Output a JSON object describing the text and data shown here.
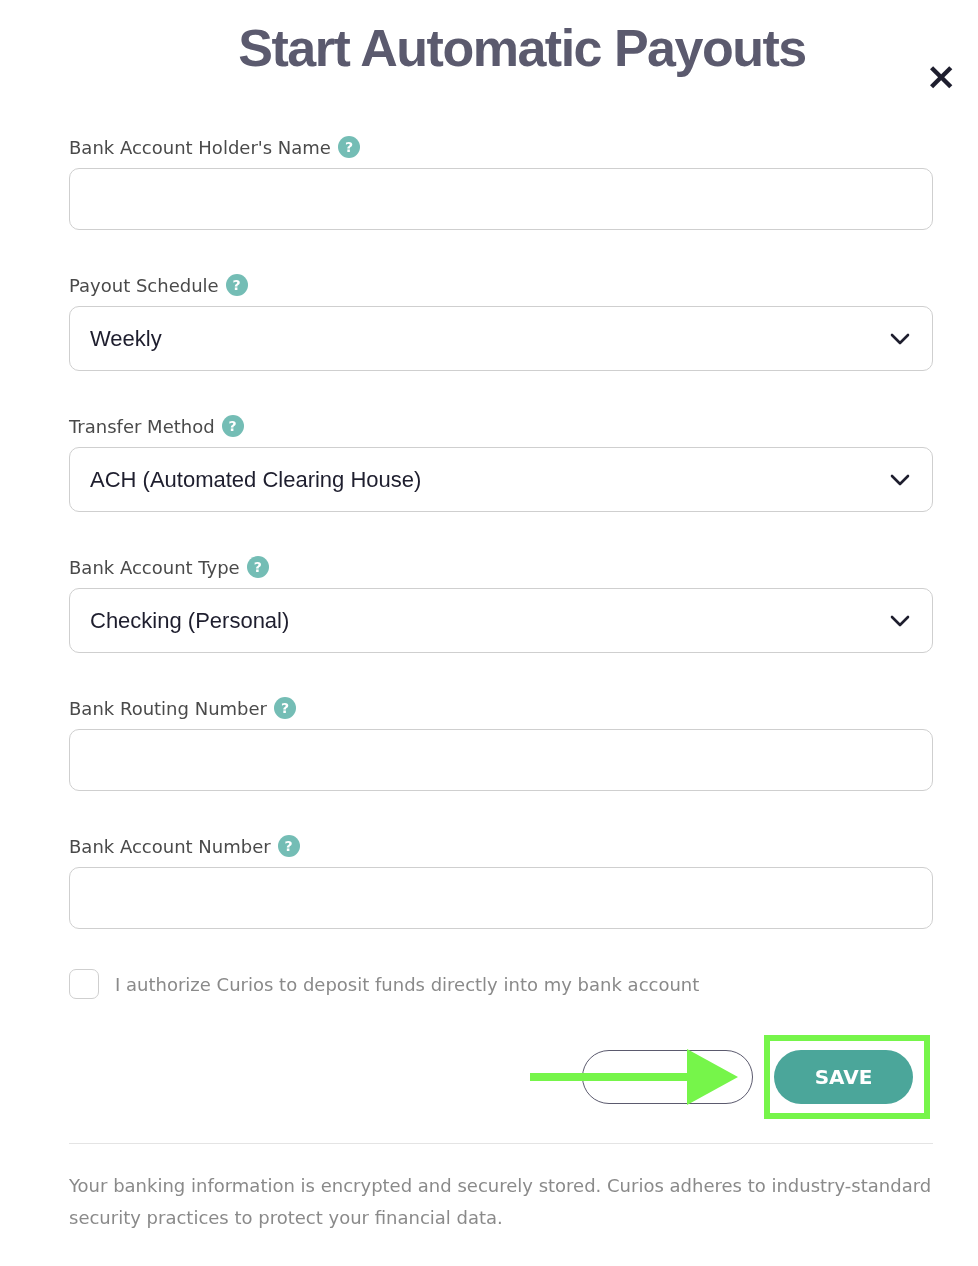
{
  "dialog": {
    "title": "Start Automatic Payouts",
    "close": "×"
  },
  "fields": [
    {
      "kind": "text",
      "label": "Bank Account Holder's Name",
      "help": "?"
    },
    {
      "kind": "select",
      "label": "Payout Schedule",
      "help": "?",
      "value": "Weekly"
    },
    {
      "kind": "select",
      "label": "Transfer Method",
      "help": "?",
      "value": "ACH (Automated Clearing House)"
    },
    {
      "kind": "select",
      "label": "Bank Account Type",
      "help": "?",
      "value": "Checking (Personal)"
    },
    {
      "kind": "text",
      "label": "Bank Routing Number",
      "help": "?"
    },
    {
      "kind": "text",
      "label": "Bank Account Number",
      "help": "?"
    }
  ],
  "consent": {
    "label": "I authorize Curios to deposit funds directly into my bank account",
    "checked": false
  },
  "buttons": [
    {
      "kind": "secondary"
    },
    {
      "kind": "primary",
      "label": "SAVE"
    }
  ],
  "footer": "Your banking information is encrypted and securely stored. Curios adheres to industry-standard security practices to protect your financial data."
}
